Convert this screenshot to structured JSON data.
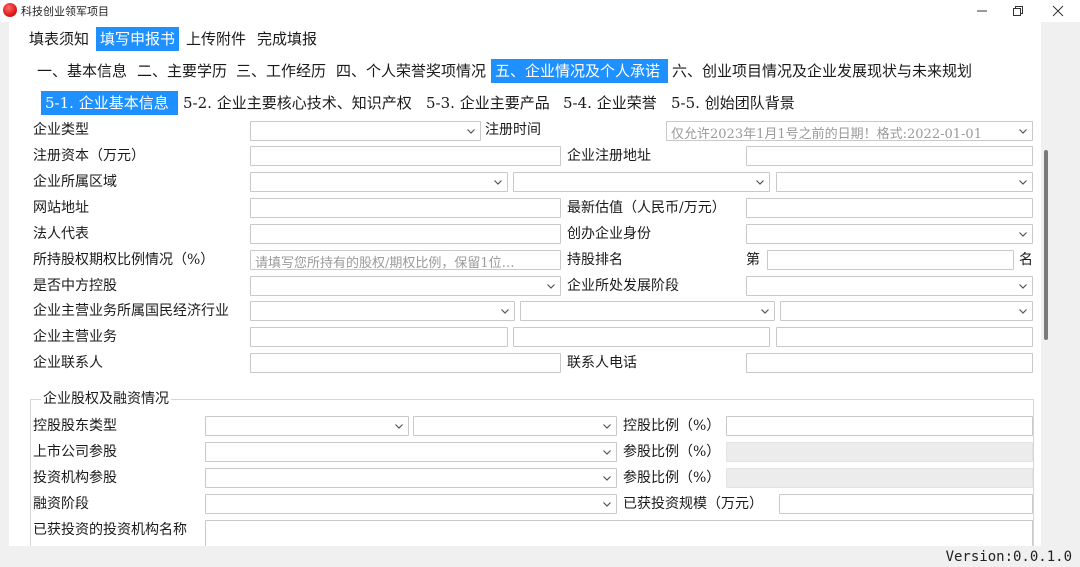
{
  "window": {
    "title": "科技创业领军项目",
    "min_icon": "minimize-icon",
    "max_icon": "restore-icon",
    "close_icon": "close-icon",
    "accent_color": "#1e90ff"
  },
  "top_tabs": [
    "填表须知",
    "填写申报书",
    "上传附件",
    "完成填报"
  ],
  "top_active": "填写申报书",
  "section_tabs": [
    "一、基本信息",
    "二、主要学历",
    "三、工作经历",
    "四、个人荣誉奖项情况",
    "五、企业情况及个人承诺",
    "六、创业项目情况及企业发展现状与未来规划"
  ],
  "section_active": "五、企业情况及个人承诺",
  "sub_tabs": [
    "5-1. 企业基本信息",
    "5-2. 企业主要核心技术、知识产权",
    "5-3. 企业主要产品",
    "5-4. 企业荣誉",
    "5-5. 创始团队背景"
  ],
  "sub_active": "5-1. 企业基本信息",
  "form": {
    "enterprise_type": "企业类型",
    "reg_time": "注册时间",
    "reg_time_placeholder": "仅允许2023年1月1号之前的日期！格式:2022-01-01",
    "reg_capital": "注册资本（万元）",
    "reg_address": "企业注册地址",
    "region": "企业所属区域",
    "website": "网站地址",
    "latest_valuation": "最新估值（人民币/万元）",
    "legal_rep": "法人代表",
    "founder_identity": "创办企业身份",
    "equity_ratio": "所持股权期权比例情况（%）",
    "equity_ratio_placeholder": "请填写您所持有的股权/期权比例，保留1位…",
    "holding_rank": "持股排名",
    "rank_prefix": "第",
    "rank_suffix": "名",
    "chinese_controlled": "是否中方控股",
    "dev_stage": "企业所处发展阶段",
    "industry": "企业主营业务所属国民经济行业",
    "main_business": "企业主营业务",
    "contact": "企业联系人",
    "contact_phone": "联系人电话"
  },
  "financing": {
    "title": "企业股权及融资情况",
    "controlling_type": "控股股东类型",
    "controlling_ratio": "控股比例（%）",
    "listed_participation": "上市公司参股",
    "listed_ratio": "参股比例（%）",
    "institution_participation": "投资机构参股",
    "institution_ratio": "参股比例（%）",
    "stage": "融资阶段",
    "scale": "已获投资规模（万元）",
    "institution_names": "已获投资的投资机构名称"
  },
  "version": "Version:0.0.1.0"
}
